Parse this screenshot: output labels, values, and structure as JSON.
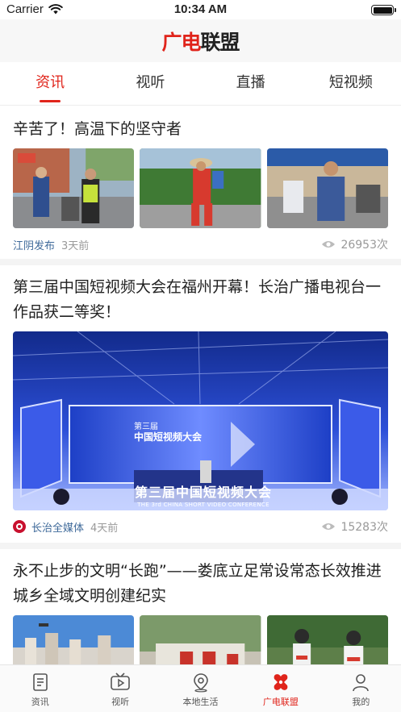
{
  "status": {
    "carrier": "Carrier",
    "time": "10:34 AM"
  },
  "app": {
    "logo_part1": "广电",
    "logo_part2": "联盟"
  },
  "tabs": [
    {
      "label": "资讯",
      "active": true
    },
    {
      "label": "视听",
      "active": false
    },
    {
      "label": "直播",
      "active": false
    },
    {
      "label": "短视频",
      "active": false
    }
  ],
  "articles": [
    {
      "title": "辛苦了！高温下的坚守者",
      "source": "江阴发布",
      "time": "3天前",
      "views": "26953次"
    },
    {
      "title": "第三届中国短视频大会在福州开幕！长治广播电视台一作品获二等奖！",
      "source": "长治全媒体",
      "time": "4天前",
      "views": "15283次",
      "image_text": {
        "headline": "第三届中国短视频大会",
        "subline": "THE 3rd CHINA SHORT VIDEO CONFERENCE",
        "screen1": "第三届",
        "screen2": "中国短视频大会"
      }
    },
    {
      "title": "永不止步的文明“长跑”——娄底立足常设常态长效推进城乡全域文明创建纪实"
    }
  ],
  "bottom_nav": [
    {
      "label": "资讯",
      "icon": "news-icon",
      "active": false
    },
    {
      "label": "视听",
      "icon": "tv-icon",
      "active": false
    },
    {
      "label": "本地生活",
      "icon": "location-icon",
      "active": false
    },
    {
      "label": "广电联盟",
      "icon": "union-icon",
      "active": true
    },
    {
      "label": "我的",
      "icon": "person-icon",
      "active": false
    }
  ],
  "colors": {
    "accent": "#e0241b",
    "source_link": "#3f6a9a",
    "muted": "#999999"
  }
}
